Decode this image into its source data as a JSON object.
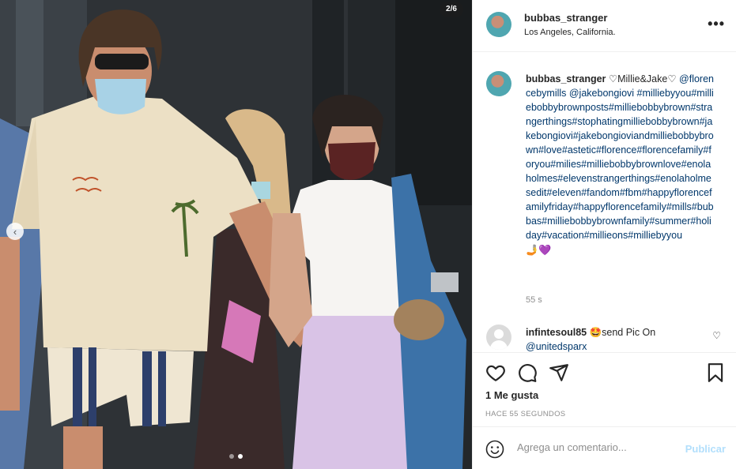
{
  "photo": {
    "counter": "2/6",
    "dots": [
      false,
      true,
      false,
      false,
      false,
      false
    ]
  },
  "header": {
    "username": "bubbas_stranger",
    "location": "Los Angeles, California.",
    "more_icon": "more-horizontal-icon"
  },
  "caption": {
    "username": "bubbas_stranger",
    "title": "♡Millie&Jake♡",
    "mentions": "@florencebymills @jakebongiovi",
    "hashtags": "#milliebyyou#milliebobbybrownposts#milliebobbybrown#strangerthings#stophatingmilliebobbybrown#jakebongiovi#jakebongioviandmilliebobbybrown#love#astetic#florence#florencefamily#foryou#milies#milliebobbybrownlove#enolaholmes#elevenstrangerthings#enolaholmesedit#eleven#fandom#fbm#happyflorencefamilyfriday#happyflorencefamily#mills#bubbas#milliebobbybrownfamily#summer#holiday#vacation#millieons#milliebyyou",
    "emojis": "🤳💜",
    "time": "55 s"
  },
  "comment": {
    "username": "infintesoul85",
    "text": "🤩send Pic On",
    "mention": "@unitedsparx"
  },
  "actions": {
    "likes": "1 Me gusta",
    "time": "HACE 55 SEGUNDOS"
  },
  "add_comment": {
    "placeholder": "Agrega un comentario...",
    "post_label": "Publicar"
  }
}
